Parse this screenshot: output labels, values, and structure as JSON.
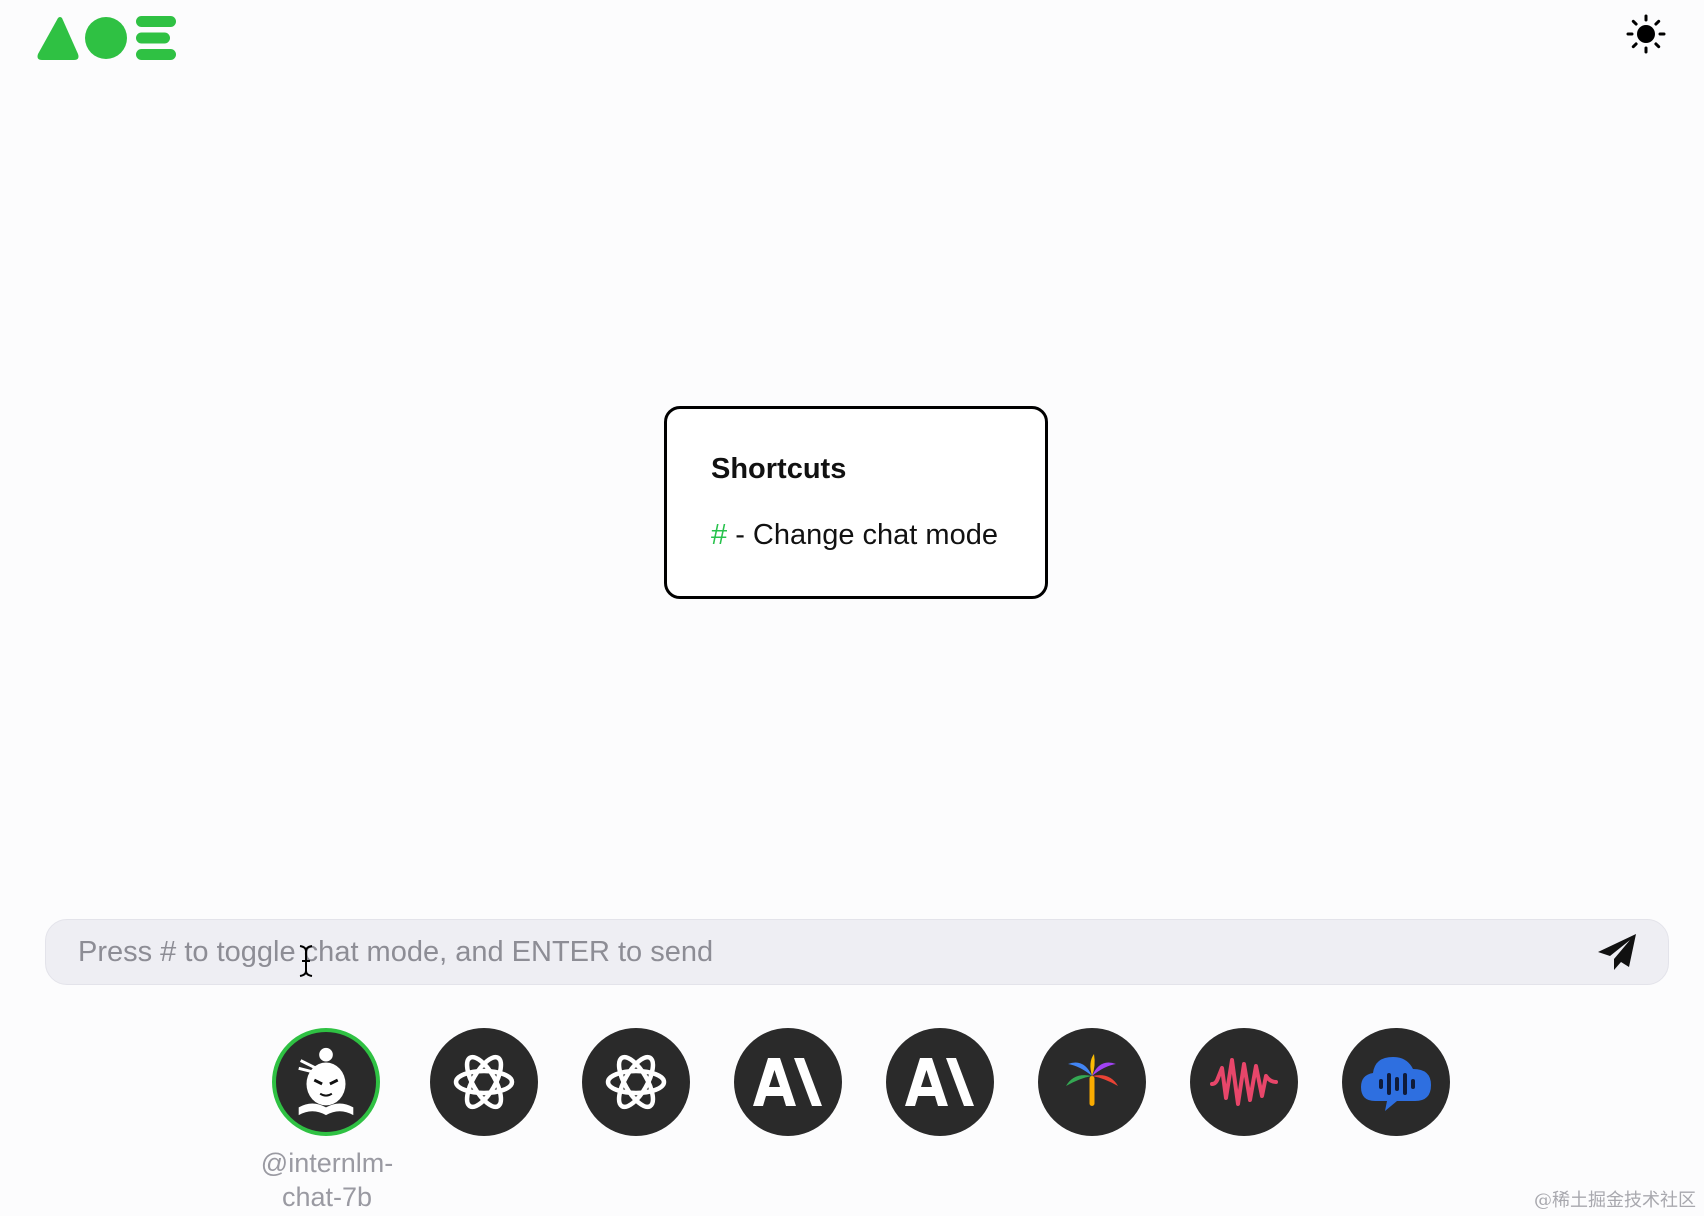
{
  "header": {
    "logo": "aoe-logo",
    "theme_toggle_icon": "sun-icon"
  },
  "shortcuts": {
    "title": "Shortcuts",
    "items": [
      {
        "key": "#",
        "description": " - Change chat mode"
      }
    ]
  },
  "composer": {
    "placeholder": "Press # to toggle chat mode, and ENTER to send",
    "send_icon": "paper-plane-icon"
  },
  "models": [
    {
      "icon": "internlm-mascot-icon",
      "label": "@internlm-chat-7b",
      "selected": true
    },
    {
      "icon": "openai-logo-icon",
      "selected": false
    },
    {
      "icon": "openai-logo-icon",
      "selected": false
    },
    {
      "icon": "anthropic-logo-icon",
      "selected": false
    },
    {
      "icon": "anthropic-logo-icon",
      "selected": false
    },
    {
      "icon": "palm-tree-icon",
      "selected": false
    },
    {
      "icon": "sound-wave-icon",
      "selected": false
    },
    {
      "icon": "cloud-voice-icon",
      "selected": false
    }
  ],
  "colors": {
    "accent": "#2fc143",
    "shortcut_key": "#27c24c",
    "avatar_bg": "#2a2a2a"
  },
  "watermark": "@稀土掘金技术社区"
}
